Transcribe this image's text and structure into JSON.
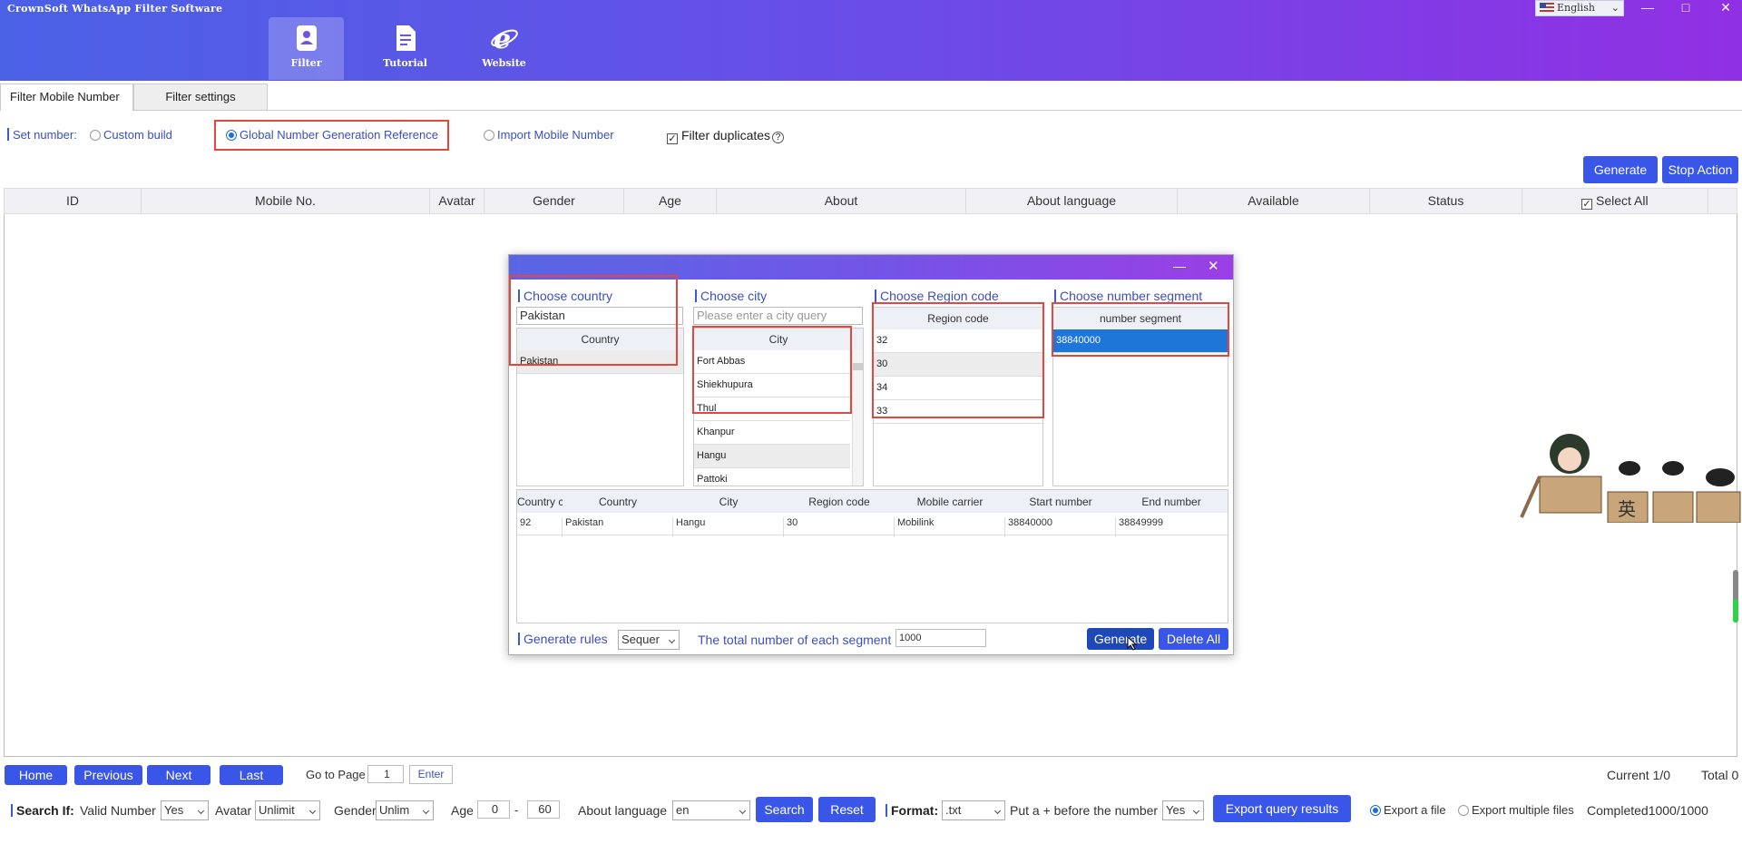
{
  "app": {
    "title": "CrownSoft WhatsApp Filter Software"
  },
  "nav": {
    "items": [
      {
        "label": "Filter"
      },
      {
        "label": "Tutorial"
      },
      {
        "label": "Website"
      }
    ]
  },
  "language": "English",
  "window_controls": {
    "minimize": "—",
    "maximize": "□",
    "close": "✕"
  },
  "tabs": [
    "Filter Mobile Number",
    "Filter settings"
  ],
  "set_number": {
    "label": "Set number:",
    "options": [
      "Custom build",
      "Global Number Generation Reference",
      "Import Mobile Number"
    ],
    "selected": "Global Number Generation Reference",
    "filter_duplicates": "Filter duplicates",
    "filter_duplicates_checked": true
  },
  "actions": {
    "generate": "Generate",
    "stop": "Stop Action"
  },
  "grid": {
    "columns": [
      "ID",
      "Mobile No.",
      "Avatar",
      "Gender",
      "Age",
      "About",
      "About language",
      "Available",
      "Status"
    ],
    "select_all": "Select All"
  },
  "dialog": {
    "choose_country": "Choose country",
    "country_value": "Pakistan",
    "country_header": "Country",
    "countries": [
      "Pakistan"
    ],
    "choose_city": "Choose city",
    "city_placeholder": "Please enter a city query",
    "city_header": "City",
    "cities": [
      "Fort Abbas",
      "Shiekhupura",
      "Thul",
      "Khanpur",
      "Hangu",
      "Pattoki"
    ],
    "choose_region": "Choose Region code",
    "region_header": "Region code",
    "regions": [
      "32",
      "30",
      "34",
      "33"
    ],
    "choose_segment": "Choose number segment",
    "segment_header": "number segment",
    "segments": [
      "38840000"
    ],
    "result_columns": [
      "Country c",
      "Country",
      "City",
      "Region code",
      "Mobile carrier",
      "Start number",
      "End number"
    ],
    "result_rows": [
      [
        "92",
        "Pakistan",
        "Hangu",
        "30",
        "Mobilink",
        "38840000",
        "38849999"
      ]
    ],
    "generate_rules": "Generate rules",
    "rule_value": "Sequer",
    "total_label": "The total number of each segment",
    "total_value": "1000",
    "generate": "Generate",
    "delete_all": "Delete All"
  },
  "pager": {
    "home": "Home",
    "previous": "Previous",
    "next": "Next",
    "last": "Last",
    "goto": "Go to Page",
    "page": "1",
    "enter": "Enter",
    "current": "Current 1/0",
    "total": "Total 0"
  },
  "search": {
    "label": "Search If:",
    "valid_number": "Valid Number",
    "valid_value": "Yes",
    "avatar": "Avatar",
    "avatar_value": "Unlimit",
    "gender": "Gender",
    "gender_value": "Unlim",
    "age": "Age",
    "age_from": "0",
    "dash": "-",
    "age_to": "60",
    "about_language": "About language",
    "lang_value": "en",
    "search": "Search",
    "reset": "Reset"
  },
  "format": {
    "label": "Format:",
    "value": ".txt",
    "plus_label": "Put a + before the number",
    "plus_value": "Yes",
    "export": "Export query results",
    "export_file": "Export a file",
    "export_multiple": "Export multiple files",
    "completed": "Completed1000/1000"
  }
}
